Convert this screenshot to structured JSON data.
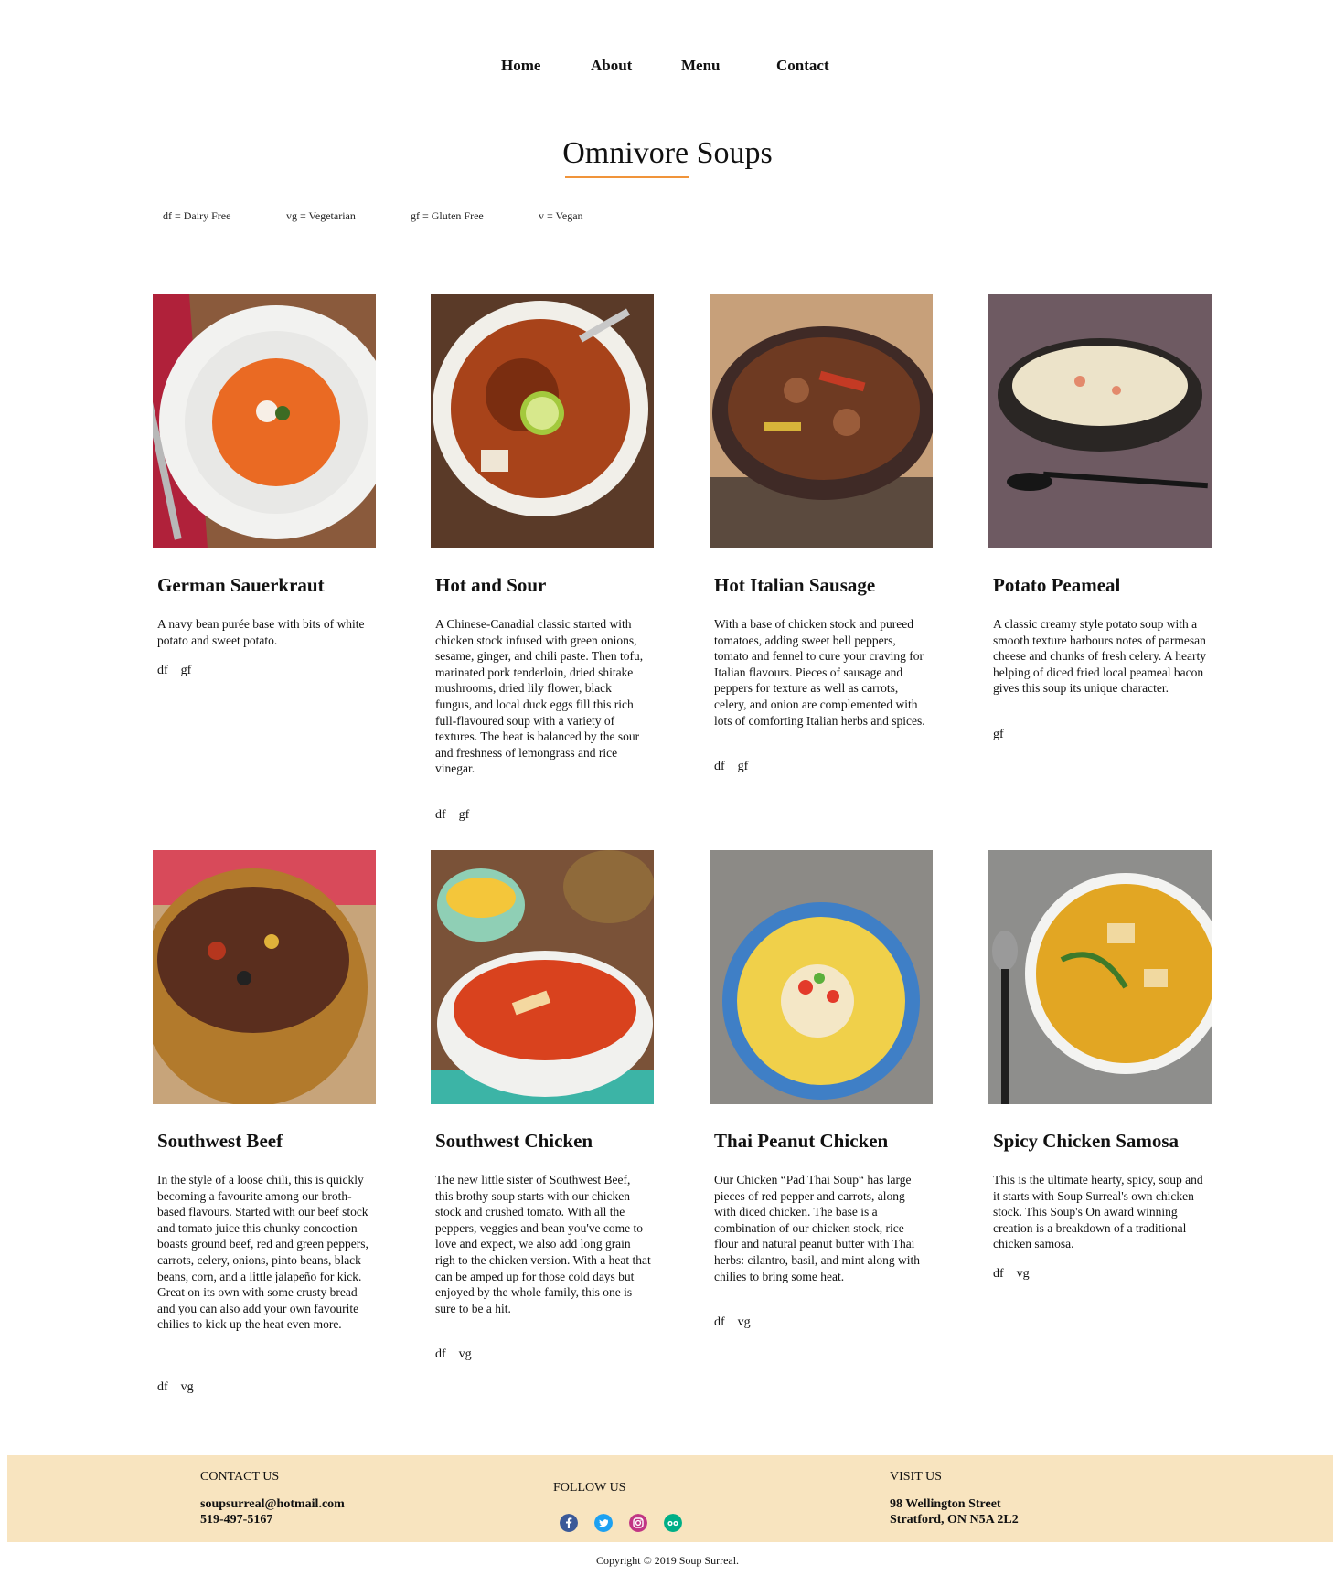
{
  "nav": {
    "items": [
      "Home",
      "About",
      "Menu",
      "Contact"
    ]
  },
  "page": {
    "title": "Omnivore Soups"
  },
  "legend": [
    "df = Dairy Free",
    "vg = Vegetarian",
    "gf = Gluten Free",
    "v = Vegan"
  ],
  "soups": [
    {
      "name": "German Sauerkraut",
      "description": "A navy bean purée base with bits of white potato and sweet potato.",
      "tags": [
        "df",
        "gf"
      ]
    },
    {
      "name": "Hot and Sour",
      "description": "A Chinese-Canadial classic started with chicken stock infused with green onions, sesame, ginger, and chili paste. Then tofu, marinated pork tenderloin, dried shitake mushrooms, dried lily flower, black fungus, and local duck eggs fill this rich full-flavoured soup with a variety of textures. The heat is balanced by the sour and freshness of lemongrass and rice vinegar.",
      "tags": [
        "df",
        "gf"
      ]
    },
    {
      "name": "Hot Italian Sausage",
      "description": "With a base of chicken stock and pureed tomatoes, adding sweet bell peppers, tomato and fennel to cure your craving for Italian flavours. Pieces of sausage and peppers for texture as well as carrots, celery, and onion are complemented with lots of comforting Italian herbs and spices.",
      "tags": [
        "df",
        "gf"
      ]
    },
    {
      "name": "Potato Peameal",
      "description": "A classic creamy style potato soup with a smooth texture harbours notes of parmesan cheese and chunks of fresh celery. A hearty helping of diced fried local peameal bacon gives this soup its unique character.",
      "tags": [
        "gf"
      ]
    },
    {
      "name": "Southwest Beef",
      "description": "In the style of a loose chili, this is quickly becoming a favourite among our broth-based flavours. Started with our beef stock and tomato juice this chunky concoction boasts ground beef, red and green peppers, carrots, celery, onions, pinto beans, black beans, corn, and a little jalapeño for kick. Great on its own with some crusty bread and you can also add your own favourite chilies to kick up the heat even more.",
      "tags": [
        "df",
        "vg"
      ]
    },
    {
      "name": "Southwest Chicken",
      "description": "The new little sister of Southwest Beef, this brothy soup starts with our chicken stock and crushed tomato. With all the peppers, veggies and bean you've come to love and expect, we also add long grain righ to the chicken version. With a heat that can be amped up for those cold days but enjoyed by the whole family, this one is sure to be a hit.",
      "tags": [
        "df",
        "vg"
      ]
    },
    {
      "name": "Thai Peanut Chicken",
      "description": "Our Chicken “Pad Thai Soup“ has large pieces of red pepper and carrots, along with diced chicken. The base is a combination of our chicken stock, rice flour and natural peanut butter with Thai herbs: cilantro, basil, and mint along with chilies to bring some heat.",
      "tags": [
        "df",
        "vg"
      ]
    },
    {
      "name": "Spicy Chicken Samosa",
      "description": "This is the ultimate hearty, spicy, soup and it starts with Soup Surreal's own chicken stock. This Soup's On award winning creation is a breakdown of a traditional chicken samosa.",
      "tags": [
        "df",
        "vg"
      ]
    }
  ],
  "footer": {
    "contact_heading": "CONTACT US",
    "email": "soupsurreal@hotmail.com",
    "phone": "519-497-5167",
    "follow_heading": "FOLLOW US",
    "social": [
      "facebook-icon",
      "twitter-icon",
      "instagram-icon",
      "tripadvisor-icon"
    ],
    "visit_heading": "VISIT US",
    "address_line1": "98 Wellington Street",
    "address_line2": "Stratford, ON N5A 2L2",
    "copyright": "Copyright © 2019 Soup Surreal."
  }
}
